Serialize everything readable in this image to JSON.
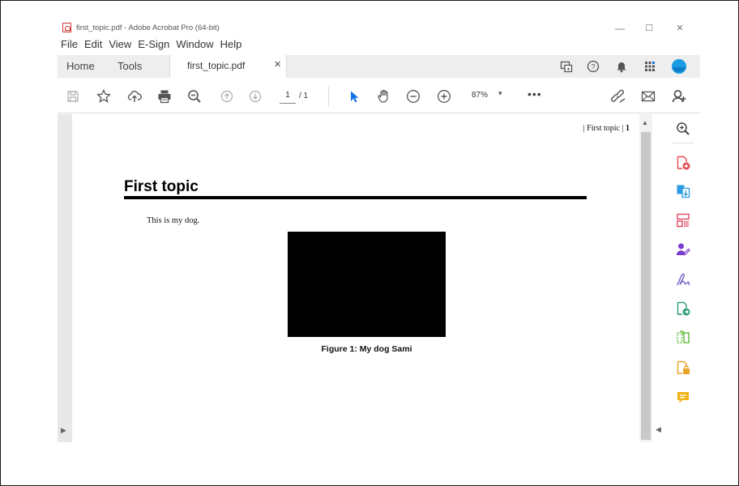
{
  "window": {
    "title": "first_topic.pdf - Adobe Acrobat Pro (64-bit)",
    "minimize": "—",
    "maximize": "☐",
    "close": "✕"
  },
  "menu": [
    "File",
    "Edit",
    "View",
    "E-Sign",
    "Window",
    "Help"
  ],
  "tabs": {
    "home": "Home",
    "tools": "Tools",
    "document": "first_topic.pdf",
    "document_close": "✕"
  },
  "toolbar": {
    "page_current": "1",
    "page_total": "/ 1",
    "zoom": "87%",
    "more": "•••"
  },
  "document": {
    "running_head_prefix": "| First topic | ",
    "running_head_page": "1",
    "section_title": "First topic",
    "body_text": "This is my dog.",
    "figure_caption": "Figure 1: My dog Sami"
  },
  "icons": {
    "header": [
      "share-screen-icon",
      "help-icon",
      "bell-icon",
      "apps-grid-icon",
      "account-avatar-icon"
    ],
    "toolbar": [
      "save-icon",
      "bookmark-star-icon",
      "cloud-upload-icon",
      "print-icon",
      "zoom-out-search-icon",
      "page-up-icon",
      "page-down-icon",
      "select-cursor-icon",
      "hand-tool-icon",
      "zoom-minus-icon",
      "zoom-plus-icon",
      "link-icon",
      "email-icon",
      "add-user-icon"
    ],
    "tools_pane": [
      "zoom-search-icon",
      "create-pdf-icon",
      "export-pdf-icon",
      "organize-pages-icon",
      "request-signature-icon",
      "fill-sign-icon",
      "send-file-icon",
      "compress-icon",
      "protect-file-icon",
      "comment-icon"
    ]
  },
  "colors": {
    "accent_blue": "#1473e6",
    "create_red": "#e34850",
    "export_blue": "#2d9be3",
    "organize_pink": "#e0465f",
    "request_purple": "#7b3dcf",
    "fill_sign_purple": "#7461c7",
    "send_green": "#2b9a73",
    "compress_green": "#5cba36",
    "protect_orange": "#e8a427",
    "comment_yellow": "#f1b418"
  }
}
